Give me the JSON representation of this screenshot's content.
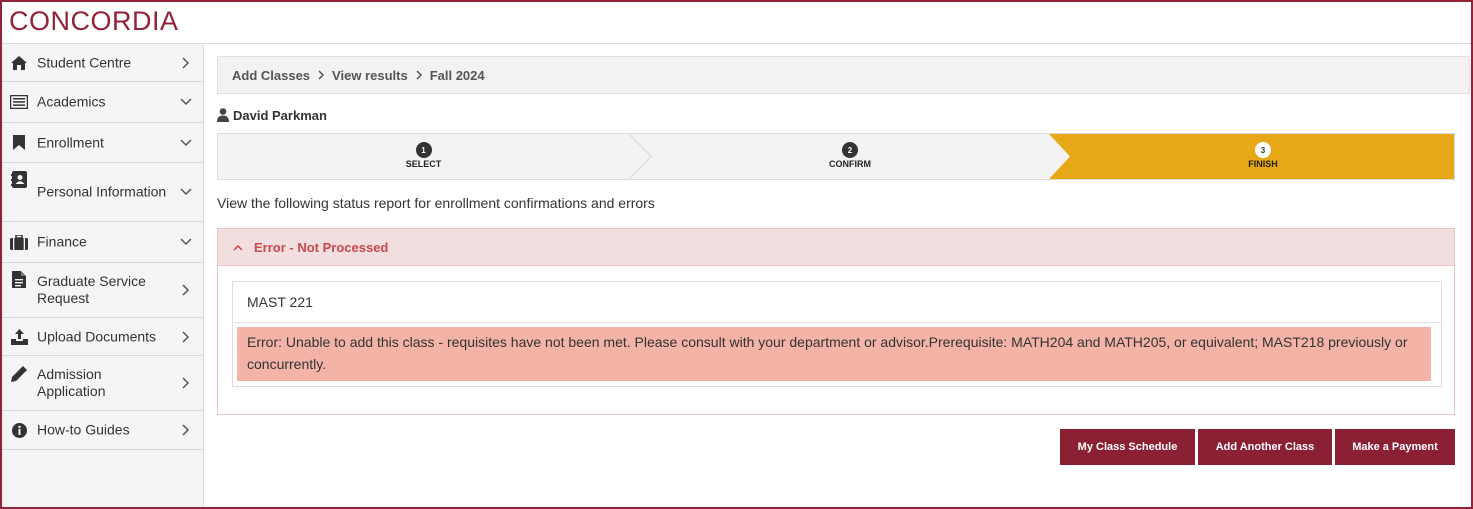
{
  "brand": {
    "logo_text": "CONCORDIA",
    "color": "#912338"
  },
  "sidebar": {
    "items": [
      {
        "label": "Student Centre",
        "icon": "home-icon",
        "chevron": "right"
      },
      {
        "label": "Academics",
        "icon": "list-icon",
        "chevron": "down"
      },
      {
        "label": "Enrollment",
        "icon": "bookmark-icon",
        "chevron": "down"
      },
      {
        "label": "Personal Information",
        "icon": "contact-book-icon",
        "chevron": "down"
      },
      {
        "label": "Finance",
        "icon": "briefcase-icon",
        "chevron": "down"
      },
      {
        "label": "Graduate Service Request",
        "icon": "document-icon",
        "chevron": "right"
      },
      {
        "label": "Upload Documents",
        "icon": "upload-icon",
        "chevron": "right"
      },
      {
        "label": "Admission Application",
        "icon": "pencil-icon",
        "chevron": "right"
      },
      {
        "label": "How-to Guides",
        "icon": "info-icon",
        "chevron": "right"
      }
    ]
  },
  "breadcrumb": {
    "items": [
      "Add Classes",
      "View results",
      "Fall 2024"
    ]
  },
  "student": {
    "name": "David Parkman",
    "icon": "user-icon"
  },
  "steps": [
    {
      "number": "1",
      "label": "SELECT",
      "active": false
    },
    {
      "number": "2",
      "label": "CONFIRM",
      "active": false
    },
    {
      "number": "3",
      "label": "FINISH",
      "active": true
    }
  ],
  "intro_text": "View the following status report for enrollment confirmations and errors",
  "error_panel": {
    "title": "Error - Not Processed",
    "course": "MAST 221",
    "message": "Error: Unable to add this class - requisites have not been met. Please consult with your department or advisor.Prerequisite: MATH204 and MATH205, or equivalent; MAST218 previously or concurrently."
  },
  "actions": {
    "schedule_label": "My Class Schedule",
    "add_label": "Add Another Class",
    "payment_label": "Make a Payment"
  },
  "colors": {
    "accent": "#912338",
    "active_step": "#e6a817",
    "error_bg": "#f4b3a7",
    "error_head_bg": "#f2dede",
    "error_text": "#c9484b"
  }
}
